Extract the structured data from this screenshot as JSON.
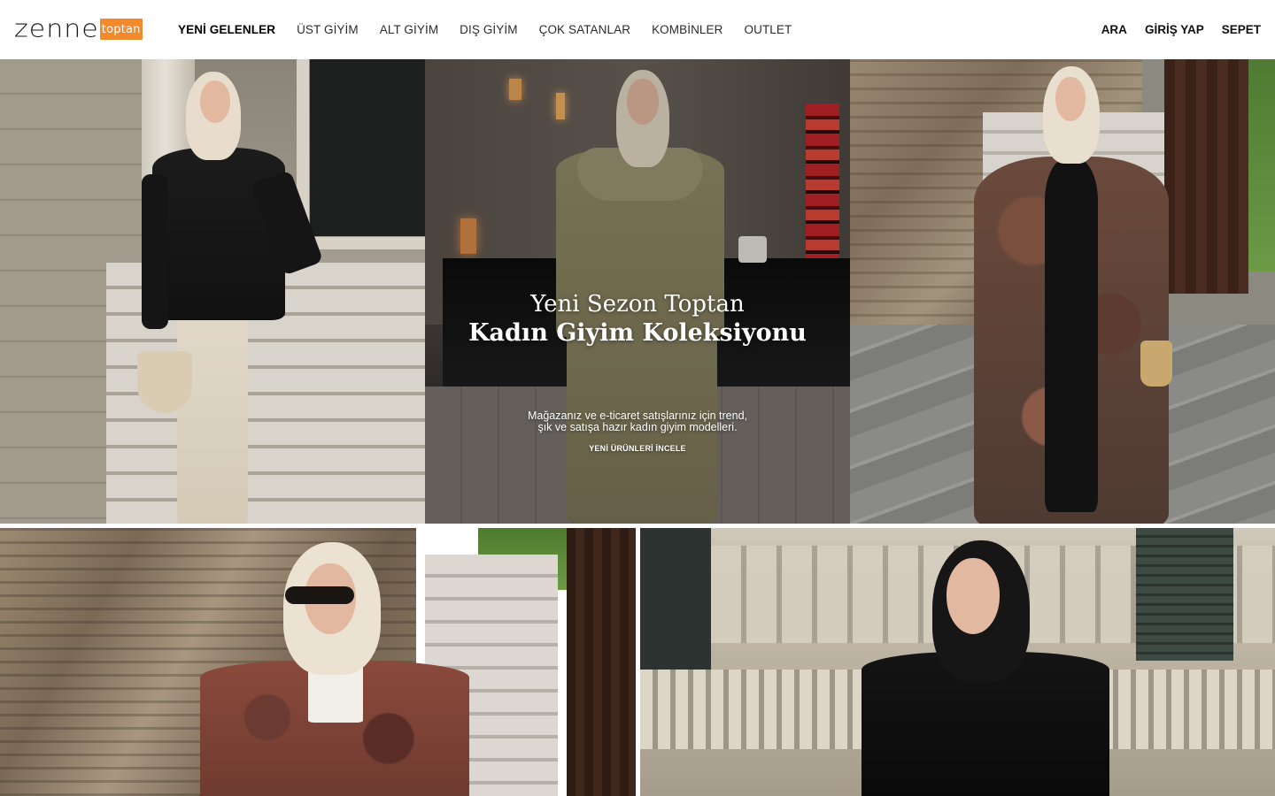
{
  "brand": {
    "wordmark": "zenne",
    "badge": "toptan",
    "accent_color": "#f28a2c"
  },
  "nav": {
    "items": [
      {
        "label": "YENİ GELENLER",
        "active": true
      },
      {
        "label": "ÜST GİYİM",
        "active": false
      },
      {
        "label": "ALT GİYİM",
        "active": false
      },
      {
        "label": "DIŞ GİYİM",
        "active": false
      },
      {
        "label": "ÇOK SATANLAR",
        "active": false
      },
      {
        "label": "KOMBİNLER",
        "active": false
      },
      {
        "label": "OUTLET",
        "active": false
      }
    ]
  },
  "utility": {
    "search": "ARA",
    "login": "GİRİŞ YAP",
    "cart": "SEPET"
  },
  "hero": {
    "kicker": "Yeni Sezon Toptan",
    "title": "Kadın Giyim Koleksiyonu",
    "desc_line1": "Mağazanız ve e-ticaret satışlarınız için trend,",
    "desc_line2": "şık ve satışa hazır kadın giyim modelleri.",
    "cta": "YENİ ÜRÜNLERİ İNCELE"
  }
}
